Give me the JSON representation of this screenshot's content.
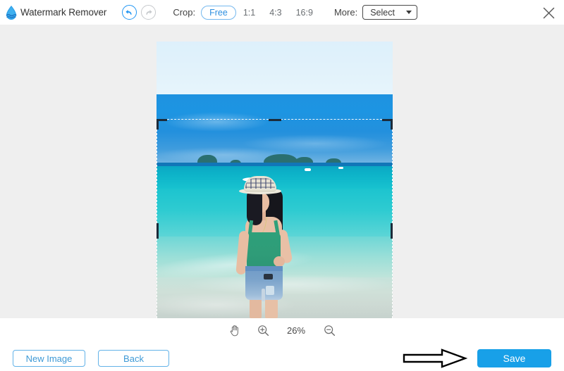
{
  "app": {
    "title": "Watermark Remover",
    "logo_icon": "water-drop-icon",
    "close_icon": "close-icon"
  },
  "toolbar": {
    "undo_icon": "undo-arrow-icon",
    "redo_icon": "redo-arrow-icon",
    "crop_label": "Crop:",
    "ratios": [
      {
        "label": "Free",
        "active": true
      },
      {
        "label": "1:1",
        "active": false
      },
      {
        "label": "4:3",
        "active": false
      },
      {
        "label": "16:9",
        "active": false
      }
    ],
    "more_label": "More:",
    "select_value": "Select",
    "select_caret_icon": "chevron-down-icon"
  },
  "canvas": {
    "pan_tool_icon": "hand-tool-icon",
    "zoom_in_icon": "zoom-in-icon",
    "zoom_out_icon": "zoom-out-icon",
    "zoom_level": "26%",
    "crop_selection": {
      "handles_icon": "crop-handle-icon"
    }
  },
  "footer": {
    "new_image_label": "New Image",
    "back_label": "Back",
    "save_label": "Save",
    "arrow_hint_icon": "arrow-right-icon"
  },
  "colors": {
    "accent": "#18a0e8",
    "outline_blue": "#63b3e8",
    "canvas_bg": "#efefef",
    "text": "#333333"
  }
}
